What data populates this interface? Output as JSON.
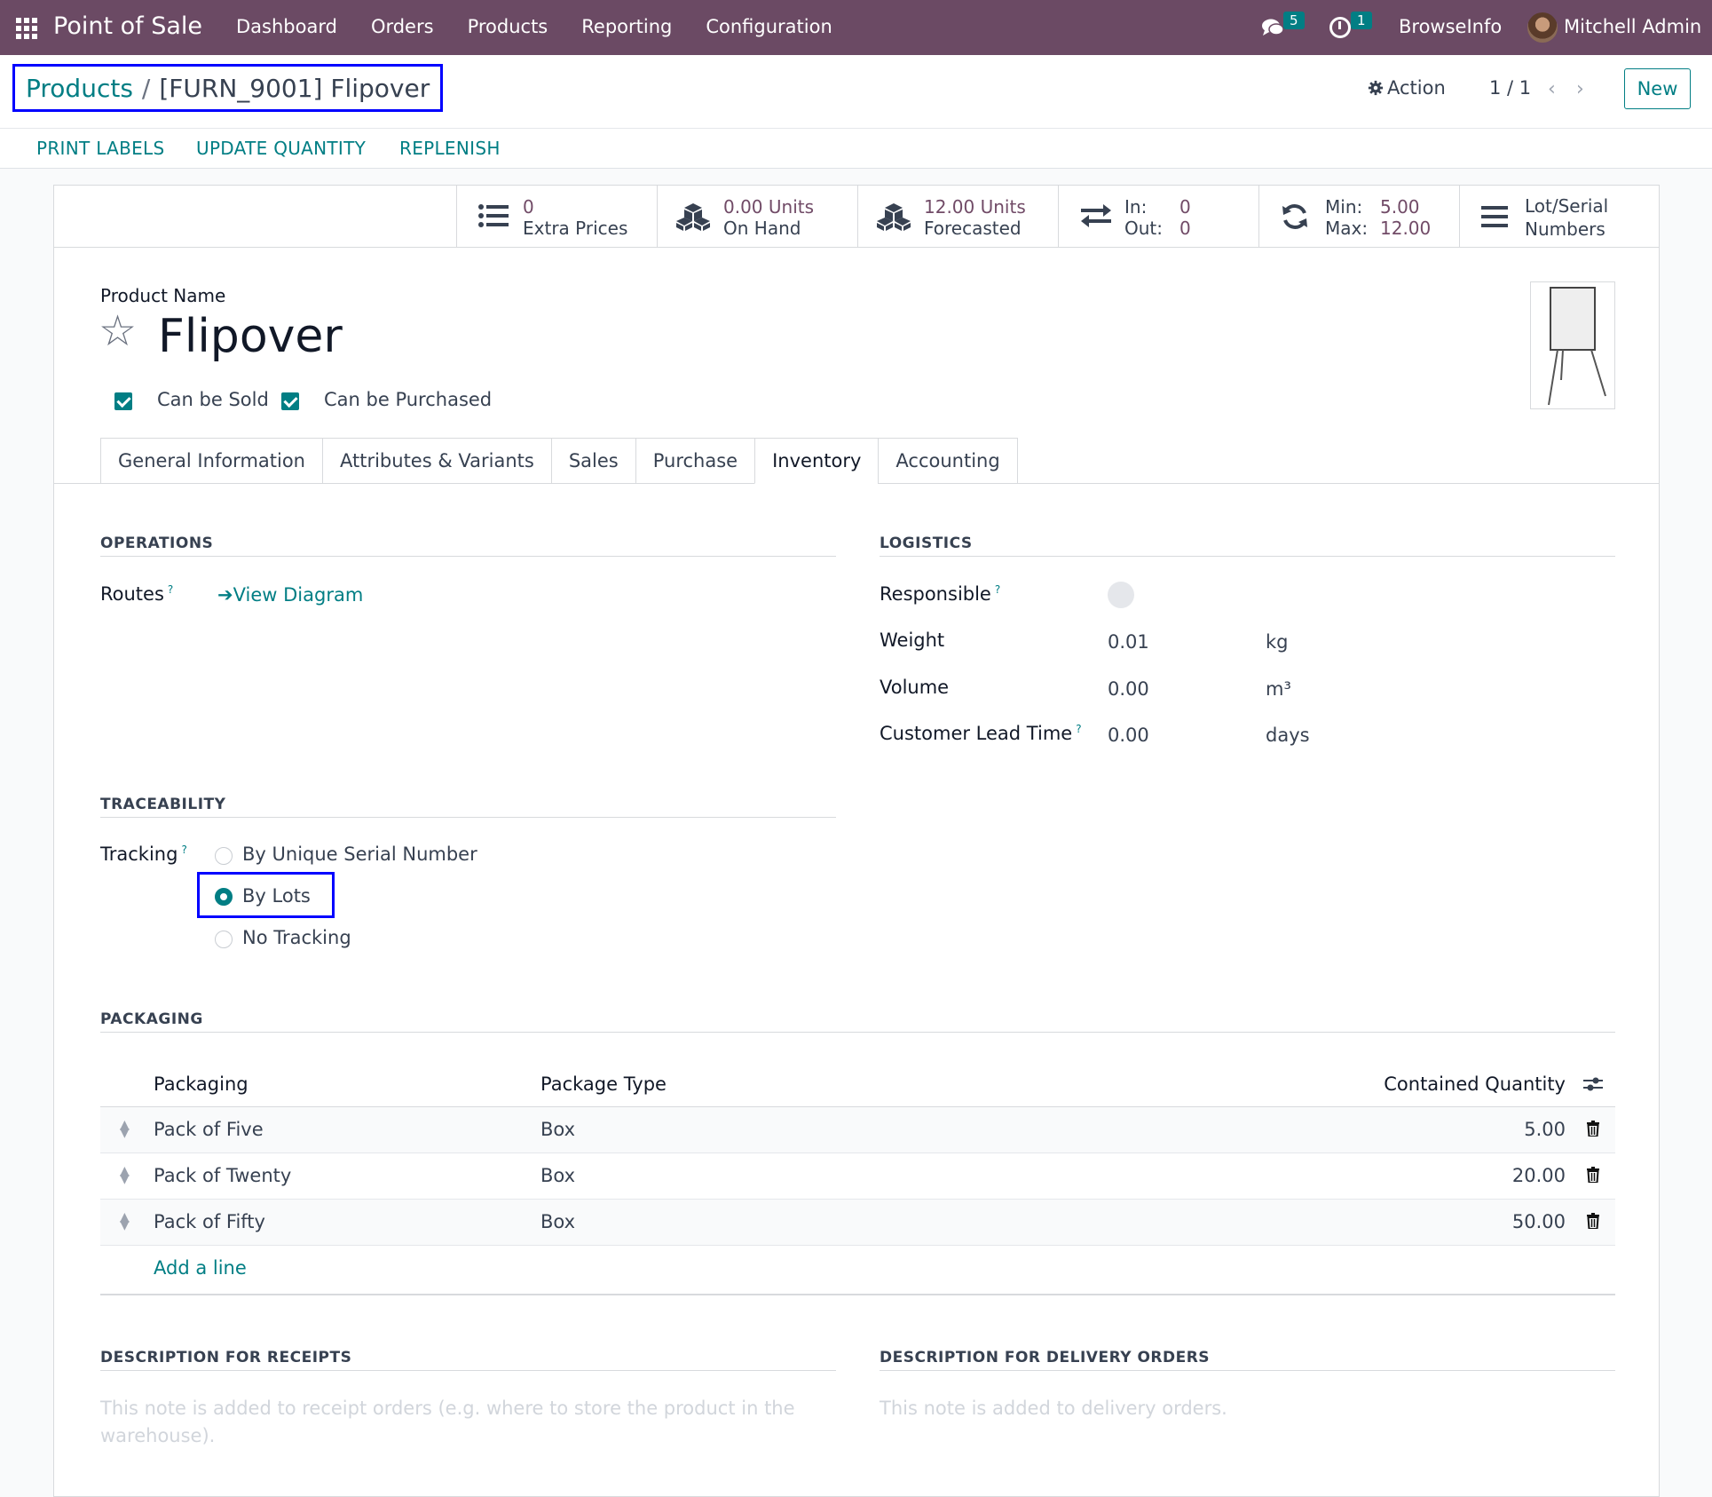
{
  "navbar": {
    "brand": "Point of Sale",
    "menu": [
      "Dashboard",
      "Orders",
      "Products",
      "Reporting",
      "Configuration"
    ],
    "chat_count": "5",
    "activity_count": "1",
    "company": "BrowseInfo",
    "user": "Mitchell Admin",
    "color": "#6b4a64"
  },
  "control": {
    "breadcrumb_parent": "Products",
    "breadcrumb_sep": "/",
    "breadcrumb_current": "[FURN_9001] Flipover",
    "action_label": "Action",
    "pager": "1 / 1",
    "new_label": "New",
    "header_buttons": [
      "PRINT LABELS",
      "UPDATE QUANTITY",
      "REPLENISH"
    ]
  },
  "stats": {
    "extra_prices_value": "0",
    "extra_prices_label": "Extra Prices",
    "on_hand_value": "0.00 Units",
    "on_hand_label": "On Hand",
    "forecasted_value": "12.00 Units",
    "forecasted_label": "Forecasted",
    "in_label": "In:",
    "in_value": "0",
    "out_label": "Out:",
    "out_value": "0",
    "min_label": "Min:",
    "min_value": "5.00",
    "max_label": "Max:",
    "max_value": "12.00",
    "lot_label_1": "Lot/Serial",
    "lot_label_2": "Numbers"
  },
  "product": {
    "name_label": "Product Name",
    "name": "Flipover",
    "can_be_sold": "Can be Sold",
    "can_be_purchased": "Can be Purchased"
  },
  "tabs": [
    "General Information",
    "Attributes & Variants",
    "Sales",
    "Purchase",
    "Inventory",
    "Accounting"
  ],
  "active_tab": "Inventory",
  "operations": {
    "title": "OPERATIONS",
    "routes_label": "Routes",
    "help": "?",
    "view_diagram": "View Diagram"
  },
  "logistics": {
    "title": "LOGISTICS",
    "responsible_label": "Responsible",
    "weight_label": "Weight",
    "weight_value": "0.01",
    "weight_unit": "kg",
    "volume_label": "Volume",
    "volume_value": "0.00",
    "volume_unit": "m³",
    "lead_label": "Customer Lead Time",
    "lead_value": "0.00",
    "lead_unit": "days"
  },
  "traceability": {
    "title": "TRACEABILITY",
    "tracking_label": "Tracking",
    "options": [
      "By Unique Serial Number",
      "By Lots",
      "No Tracking"
    ],
    "selected": "By Lots"
  },
  "packaging": {
    "title": "PACKAGING",
    "columns": [
      "Packaging",
      "Package Type",
      "Contained Quantity"
    ],
    "rows": [
      {
        "name": "Pack of Five",
        "type": "Box",
        "qty": "5.00"
      },
      {
        "name": "Pack of Twenty",
        "type": "Box",
        "qty": "20.00"
      },
      {
        "name": "Pack of Fifty",
        "type": "Box",
        "qty": "50.00"
      }
    ],
    "add_line": "Add a line"
  },
  "descriptions": {
    "receipts_title": "DESCRIPTION FOR RECEIPTS",
    "receipts_placeholder": "This note is added to receipt orders (e.g. where to store the product in the warehouse).",
    "delivery_title": "DESCRIPTION FOR DELIVERY ORDERS",
    "delivery_placeholder": "This note is added to delivery orders."
  }
}
